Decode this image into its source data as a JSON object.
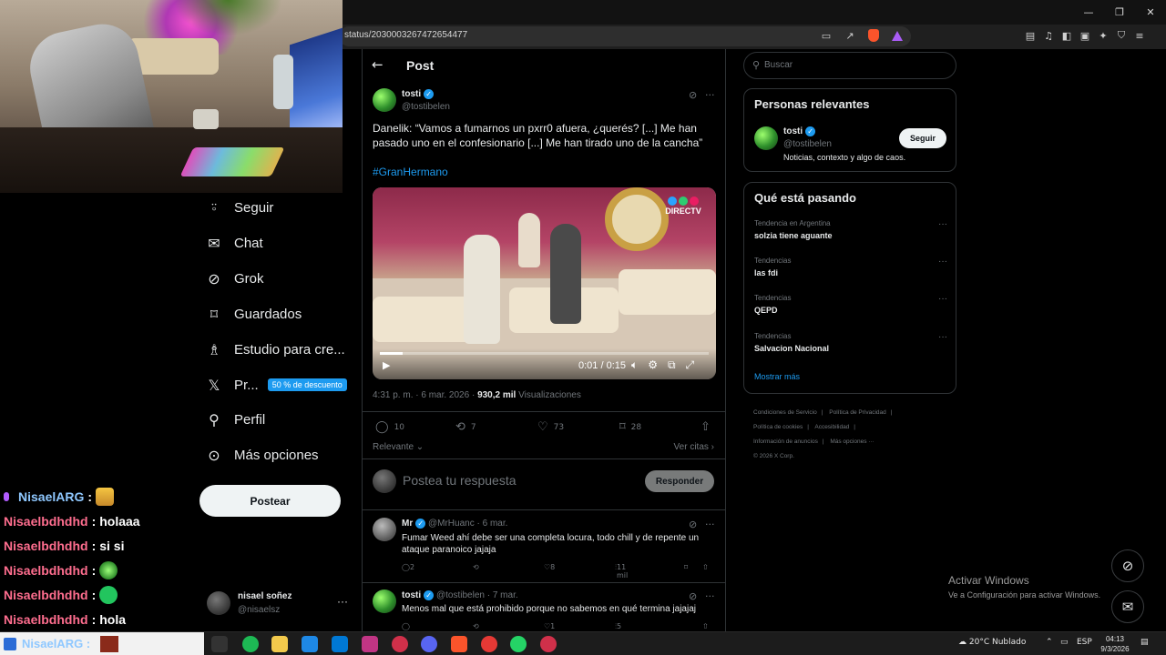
{
  "browser": {
    "url": "status/2030003267472654477",
    "window_controls": [
      "—",
      "❐",
      "✕"
    ]
  },
  "chat": {
    "lines": [
      {
        "user": "NisaelARG",
        "sep": ":",
        "message": "",
        "emote": "crown"
      },
      {
        "user": "Nisaelbdhdhd",
        "sep": ":",
        "message": "holaaa",
        "emote": ""
      },
      {
        "user": "Nisaelbdhdhd",
        "sep": ":",
        "message": "si si",
        "emote": ""
      },
      {
        "user": "Nisaelbdhdhd",
        "sep": ":",
        "message": "",
        "emote": "alien"
      },
      {
        "user": "Nisaelbdhdhd",
        "sep": ":",
        "message": "",
        "emote": "green"
      },
      {
        "user": "Nisaelbdhdhd",
        "sep": ":",
        "message": "hola",
        "emote": ""
      }
    ]
  },
  "nav": {
    "items": [
      {
        "label": "Seguir",
        "icon": "add-user-icon"
      },
      {
        "label": "Chat",
        "icon": "mail-icon"
      },
      {
        "label": "Grok",
        "icon": "grok-icon"
      },
      {
        "label": "Guardados",
        "icon": "bookmark-icon"
      },
      {
        "label": "Estudio para cre...",
        "icon": "studio-icon"
      },
      {
        "label": "Pr...",
        "icon": "x-logo-icon",
        "badge": "50 % de descuento"
      },
      {
        "label": "Perfil",
        "icon": "person-icon"
      },
      {
        "label": "Más opciones",
        "icon": "more-circle-icon"
      }
    ],
    "post_button": "Postear",
    "profile": {
      "name": "nisael soñez",
      "handle": "@nisaelsz",
      "more": "···"
    }
  },
  "post": {
    "header_title": "Post",
    "author_name": "tosti",
    "author_handle": "@tostibelen",
    "text": "Danelik: “Vamos a fumarnos un pxrr0 afuera, ¿querés? [...] Me han pasado uno en el confesionario [...] Me han tirado uno de la cancha”",
    "hashtag": "#GranHermano",
    "video": {
      "brand": "DIRECTV",
      "time": "0:01 / 0:15",
      "progress": 0.07
    },
    "timestamp": "4:31 p. m. · 6 mar. 2026 · ",
    "views_count": "930,2 mil",
    "views_label": " Visualizaciones",
    "stats": {
      "replies": "10",
      "reposts": "7",
      "likes": "73",
      "bookmarks": "28"
    },
    "sort_label": "Relevante",
    "quotes_label": "Ver citas",
    "reply_placeholder": "Postea tu respuesta",
    "reply_button": "Responder"
  },
  "replies": [
    {
      "name": "Mr",
      "meta": "@MrHuanc · 6 mar.",
      "text": "Fumar Weed ahí debe ser una completa locura, todo chill y de repente un ataque paranoico jajaja",
      "replies": "2",
      "likes": "8",
      "views": "11 mil"
    },
    {
      "name": "tosti",
      "meta": "@tostibelen · 7 mar.",
      "text": "Menos mal que está prohibido porque no sabemos en qué termina jajajaj",
      "replies": "",
      "likes": "1",
      "views": "5 mil"
    }
  ],
  "sidebar": {
    "search_placeholder": "Buscar",
    "relevant": {
      "title": "Personas relevantes",
      "name": "tosti",
      "handle": "@tostibelen",
      "follow": "Seguir",
      "bio": "Noticias, contexto y algo de caos."
    },
    "trending": {
      "title": "Qué está pasando",
      "items": [
        {
          "context": "Tendencia en Argentina",
          "name": "solzia tiene aguante"
        },
        {
          "context": "Tendencias",
          "name": "las fdi"
        },
        {
          "context": "Tendencias",
          "name": "QEPD"
        },
        {
          "context": "Tendencias",
          "name": "Salvacion Nacional"
        }
      ],
      "show_more": "Mostrar más"
    },
    "footer": [
      "Condiciones de Servicio",
      "Política de Privacidad",
      "Política de cookies",
      "Accesibilidad",
      "Información de anuncios",
      "Más opciones ···",
      "© 2026 X Corp."
    ]
  },
  "windows": {
    "activate_title": "Activar Windows",
    "activate_sub": "Ve a Configuración para activar Windows.",
    "taskbar_search": "NisaelARG :",
    "weather": "20°C  Nublado",
    "lang": "ESP",
    "time": "04:13",
    "date": "9/3/2026"
  },
  "colors": {
    "accent": "#1d9bf0",
    "chat_user": "#ff6e8f",
    "background": "#000000"
  }
}
